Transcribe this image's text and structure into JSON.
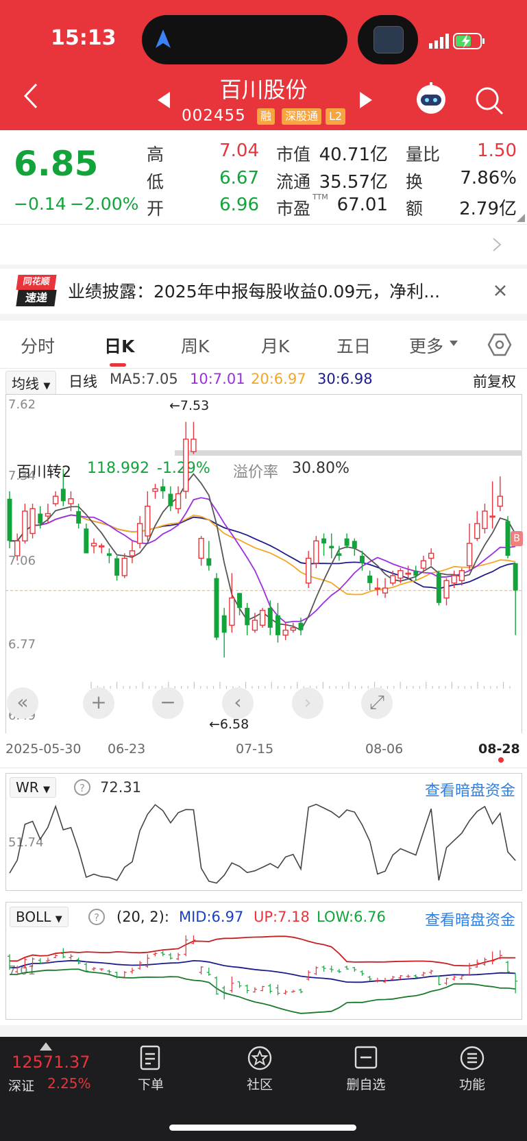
{
  "status": {
    "time": "15:13"
  },
  "header": {
    "title": "百川股份",
    "code": "002455",
    "tags": [
      "融",
      "深股通",
      "L2"
    ]
  },
  "quote": {
    "price": "6.85",
    "change": "−0.14",
    "change_pct": "−2.00%",
    "high_label": "高",
    "high": "7.04",
    "low_label": "低",
    "low": "6.67",
    "open_label": "开",
    "open": "6.96",
    "mcap_label": "市值",
    "mcap": "40.71亿",
    "float_label": "流通",
    "float": "35.57亿",
    "pe_label": "市盈",
    "pe_sup": "TTM",
    "pe": "67.01",
    "vr_label": "量比",
    "vr": "1.50",
    "turn_label": "换",
    "turn": "7.86%",
    "amt_label": "额",
    "amt": "2.79亿"
  },
  "bond": {
    "name": "百川转2",
    "price": "118.992",
    "pct": "-1.29%",
    "premium_label": "溢价率",
    "premium": "30.80%"
  },
  "news": {
    "logo_top": "同花顺",
    "logo_bottom": "速递",
    "text": "业绩披露：2025年中报每股收益0.09元，净利..."
  },
  "tabs": [
    "分时",
    "日K",
    "周K",
    "月K",
    "五日",
    "更多"
  ],
  "active_tab": "日K",
  "ma": {
    "selector": "均线",
    "period": "日线",
    "ma5": "MA5:7.05",
    "ma10": "10:7.01",
    "ma20": "20:6.97",
    "ma30": "30:6.98",
    "adjust": "前复权"
  },
  "colors": {
    "up": "#e8343b",
    "down": "#12a33a",
    "ma5": "#555555",
    "ma10": "#9b2fe0",
    "ma20": "#f5a623",
    "ma30": "#1b1b8a"
  },
  "kline": {
    "y_ticks": [
      "7.62",
      "7.34",
      "7.06",
      "6.77",
      "6.49"
    ],
    "max_label": "←7.53",
    "min_label": "←6.58",
    "dates": [
      "2025-05-30",
      "06-23",
      "07-15",
      "08-06",
      "08-28"
    ],
    "flag": "B"
  },
  "chart_data": {
    "type": "candlestick",
    "ylim": [
      6.49,
      7.62
    ],
    "y_ticks": [
      7.62,
      7.34,
      7.06,
      6.77,
      6.49
    ],
    "x_labels": [
      "2025-05-30",
      "06-23",
      "07-15",
      "08-06",
      "08-28"
    ],
    "series": [
      {
        "name": "MA5",
        "last": 7.05
      },
      {
        "name": "MA10",
        "last": 7.01
      },
      {
        "name": "MA20",
        "last": 6.97
      },
      {
        "name": "MA30",
        "last": 6.98
      }
    ],
    "candles": [
      [
        7.22,
        7.05,
        7.02,
        7.25
      ],
      [
        6.99,
        7.05,
        6.97,
        7.08
      ],
      [
        7.05,
        7.17,
        7.04,
        7.2
      ],
      [
        7.08,
        7.18,
        7.06,
        7.2
      ],
      [
        7.16,
        7.12,
        7.1,
        7.19
      ],
      [
        7.15,
        7.16,
        7.12,
        7.2
      ],
      [
        7.2,
        7.23,
        7.19,
        7.25
      ],
      [
        7.26,
        7.21,
        7.19,
        7.34
      ],
      [
        7.2,
        7.22,
        7.17,
        7.25
      ],
      [
        7.17,
        7.12,
        7.1,
        7.2
      ],
      [
        7.1,
        7.0,
        7.0,
        7.12
      ],
      [
        7.03,
        7.04,
        7.0,
        7.06
      ],
      [
        7.03,
        7.03,
        7.0,
        7.04
      ],
      [
        7.0,
        6.99,
        6.96,
        7.02
      ],
      [
        6.98,
        6.91,
        6.89,
        6.99
      ],
      [
        6.91,
        6.98,
        6.9,
        7.0
      ],
      [
        6.99,
        7.01,
        6.96,
        7.05
      ],
      [
        7.04,
        7.12,
        7.02,
        7.15
      ],
      [
        7.07,
        7.19,
        7.05,
        7.25
      ],
      [
        7.25,
        7.26,
        7.22,
        7.28
      ],
      [
        7.27,
        7.25,
        7.22,
        7.3
      ],
      [
        7.24,
        7.19,
        7.17,
        7.27
      ],
      [
        7.18,
        7.24,
        7.16,
        7.27
      ],
      [
        7.25,
        7.46,
        7.22,
        7.53
      ],
      [
        7.41,
        7.46,
        7.4,
        7.53
      ],
      [
        6.98,
        7.06,
        6.95,
        7.07
      ],
      [
        6.98,
        6.95,
        6.93,
        7.05
      ],
      [
        6.9,
        6.66,
        6.65,
        6.92
      ],
      [
        6.75,
        6.68,
        6.58,
        6.78
      ],
      [
        6.71,
        6.82,
        6.68,
        6.92
      ],
      [
        6.84,
        6.78,
        6.75,
        6.84
      ],
      [
        6.78,
        6.71,
        6.67,
        6.8
      ],
      [
        6.69,
        6.73,
        6.68,
        6.76
      ],
      [
        6.71,
        6.77,
        6.7,
        6.78
      ],
      [
        6.78,
        6.7,
        6.67,
        6.81
      ],
      [
        6.75,
        6.67,
        6.64,
        6.8
      ],
      [
        6.67,
        6.69,
        6.65,
        6.72
      ],
      [
        6.69,
        6.7,
        6.68,
        6.72
      ],
      [
        6.72,
        6.69,
        6.67,
        6.74
      ],
      [
        6.88,
        6.98,
        6.86,
        7.01
      ],
      [
        6.96,
        7.05,
        6.94,
        7.07
      ],
      [
        7.06,
        7.04,
        6.99,
        7.08
      ],
      [
        7.03,
        7.02,
        6.98,
        7.08
      ],
      [
        7.0,
        6.99,
        6.97,
        7.03
      ],
      [
        7.06,
        7.03,
        7.02,
        7.08
      ],
      [
        7.05,
        7.02,
        6.99,
        7.06
      ],
      [
        6.99,
        6.96,
        6.93,
        7.01
      ],
      [
        6.91,
        6.88,
        6.85,
        6.93
      ],
      [
        6.86,
        6.86,
        6.83,
        6.9
      ],
      [
        6.84,
        6.86,
        6.82,
        6.9
      ],
      [
        6.88,
        6.91,
        6.87,
        6.93
      ],
      [
        6.9,
        6.93,
        6.88,
        6.94
      ],
      [
        6.92,
        6.92,
        6.9,
        6.95
      ],
      [
        6.93,
        6.91,
        6.89,
        6.95
      ],
      [
        6.94,
        6.97,
        6.92,
        6.99
      ],
      [
        6.98,
        7.0,
        6.95,
        7.02
      ],
      [
        6.92,
        6.8,
        6.79,
        6.93
      ],
      [
        6.82,
        6.89,
        6.79,
        6.9
      ],
      [
        6.88,
        6.91,
        6.86,
        6.93
      ],
      [
        6.89,
        6.93,
        6.87,
        6.94
      ],
      [
        6.95,
        7.04,
        6.93,
        7.12
      ],
      [
        7.06,
        7.12,
        7.05,
        7.17
      ],
      [
        7.1,
        7.17,
        7.08,
        7.2
      ],
      [
        7.15,
        7.15,
        7.1,
        7.29
      ],
      [
        7.19,
        7.23,
        7.17,
        7.31
      ],
      [
        7.13,
        6.99,
        6.98,
        7.15
      ],
      [
        6.96,
        6.85,
        6.67,
        6.96
      ]
    ],
    "wr": {
      "value": 72.31,
      "tick": 51.74
    },
    "boll": {
      "params": "(20, 2)",
      "mid": 6.97,
      "up": 7.18,
      "low": 6.76
    }
  },
  "controls": {
    "prev_label": "‹",
    "next_label": "›"
  },
  "wr": {
    "name": "WR",
    "value": "72.31",
    "tick": "51.74",
    "link": "查看暗盘资金"
  },
  "boll": {
    "name": "BOLL",
    "params": "(20, 2):",
    "mid": "MID:6.97",
    "up": "UP:7.18",
    "low": "LOW:6.76",
    "tick": "7.01",
    "link": "查看暗盘资金"
  },
  "bottom": {
    "index_value": "12571.37",
    "index_name": "深证",
    "index_pct": "2.25%",
    "nav": [
      "下单",
      "社区",
      "删自选",
      "功能"
    ]
  }
}
